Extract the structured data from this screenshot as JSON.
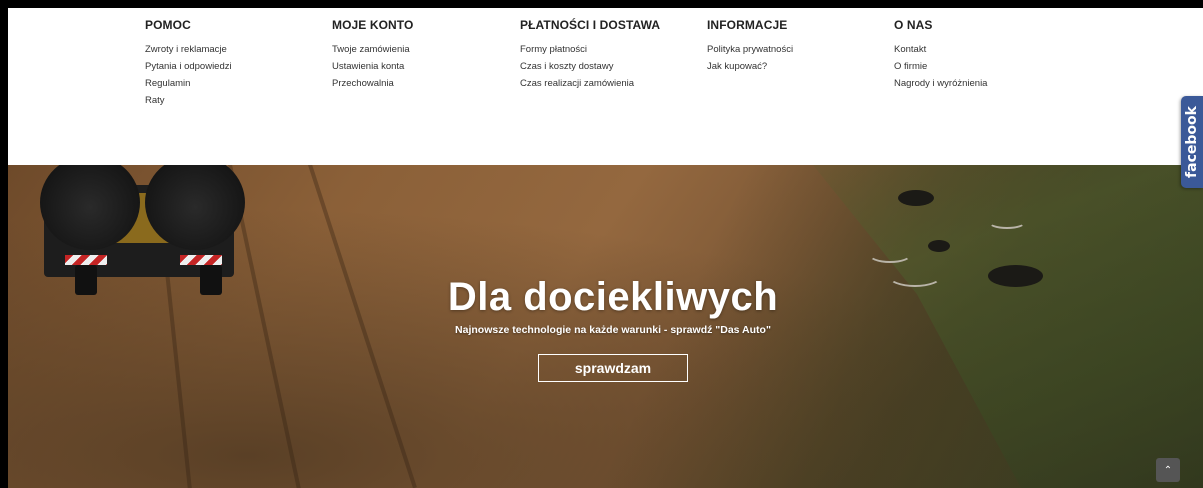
{
  "footer": {
    "columns": [
      {
        "title": "POMOC",
        "links": [
          "Zwroty i reklamacje",
          "Pytania i odpowiedzi",
          "Regulamin",
          "Raty"
        ]
      },
      {
        "title": "MOJE KONTO",
        "links": [
          "Twoje zamówienia",
          "Ustawienia konta",
          "Przechowalnia"
        ]
      },
      {
        "title": "PŁATNOŚCI I DOSTAWA",
        "links": [
          "Formy płatności",
          "Czas i koszty dostawy",
          "Czas realizacji zamówienia"
        ]
      },
      {
        "title": "INFORMACJE",
        "links": [
          "Polityka prywatności",
          "Jak kupować?"
        ]
      },
      {
        "title": "O NAS",
        "links": [
          "Kontakt",
          "O firmie",
          "Nagrody i wyróżnienia"
        ]
      }
    ]
  },
  "hero": {
    "title": "Dla dociekliwych",
    "subtitle": "Najnowsze technologie na każde warunki - sprawdź \"Das Auto\"",
    "button_label": "sprawdzam"
  },
  "facebook_tab": {
    "label": "facebook"
  },
  "scroll_top": {
    "icon": "chevron-up-icon",
    "glyph": "⌃"
  },
  "colors": {
    "facebook": "#3b5998",
    "footer_bg": "#ffffff",
    "text": "#222222"
  }
}
